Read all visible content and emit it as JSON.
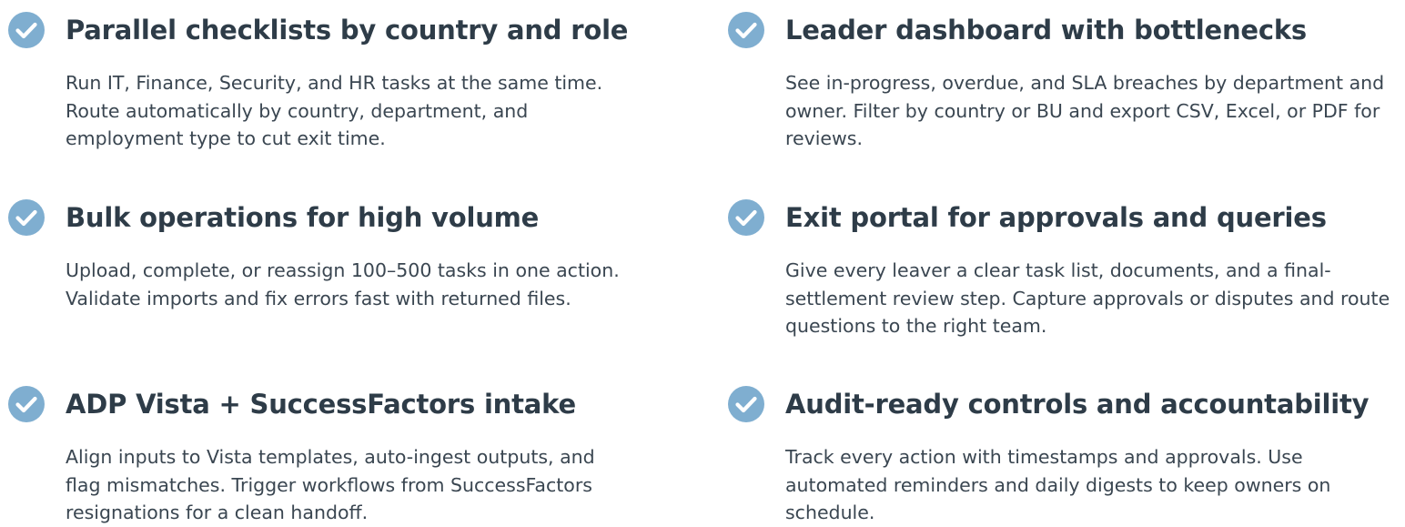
{
  "icon": {
    "name": "check-circle-icon",
    "fill": "#7faed0",
    "stroke": "#ffffff"
  },
  "features": [
    {
      "title": "Parallel checklists by country and role",
      "description": "Run IT, Finance, Security, and HR tasks at the same time. Route automatically by country, department, and employment type to cut exit time."
    },
    {
      "title": "Leader dashboard with bottlenecks",
      "description": "See in-progress, overdue, and SLA breaches by department and owner. Filter by country or BU and export CSV, Excel, or PDF for reviews."
    },
    {
      "title": "Bulk operations for high volume",
      "description": "Upload, complete, or reassign 100–500 tasks in one action. Validate imports and fix errors fast with returned files."
    },
    {
      "title": "Exit portal for approvals and queries",
      "description": "Give every leaver a clear task list, documents, and a final-settlement review step. Capture approvals or disputes and route questions to the right team."
    },
    {
      "title": "ADP Vista + SuccessFactors intake",
      "description": "Align inputs to Vista templates, auto-ingest outputs, and flag mismatches. Trigger workflows from SuccessFactors resignations for a clean handoff."
    },
    {
      "title": "Audit-ready controls and accountability",
      "description": "Track every action with timestamps and approvals. Use automated reminders and daily digests to keep owners on schedule."
    }
  ]
}
